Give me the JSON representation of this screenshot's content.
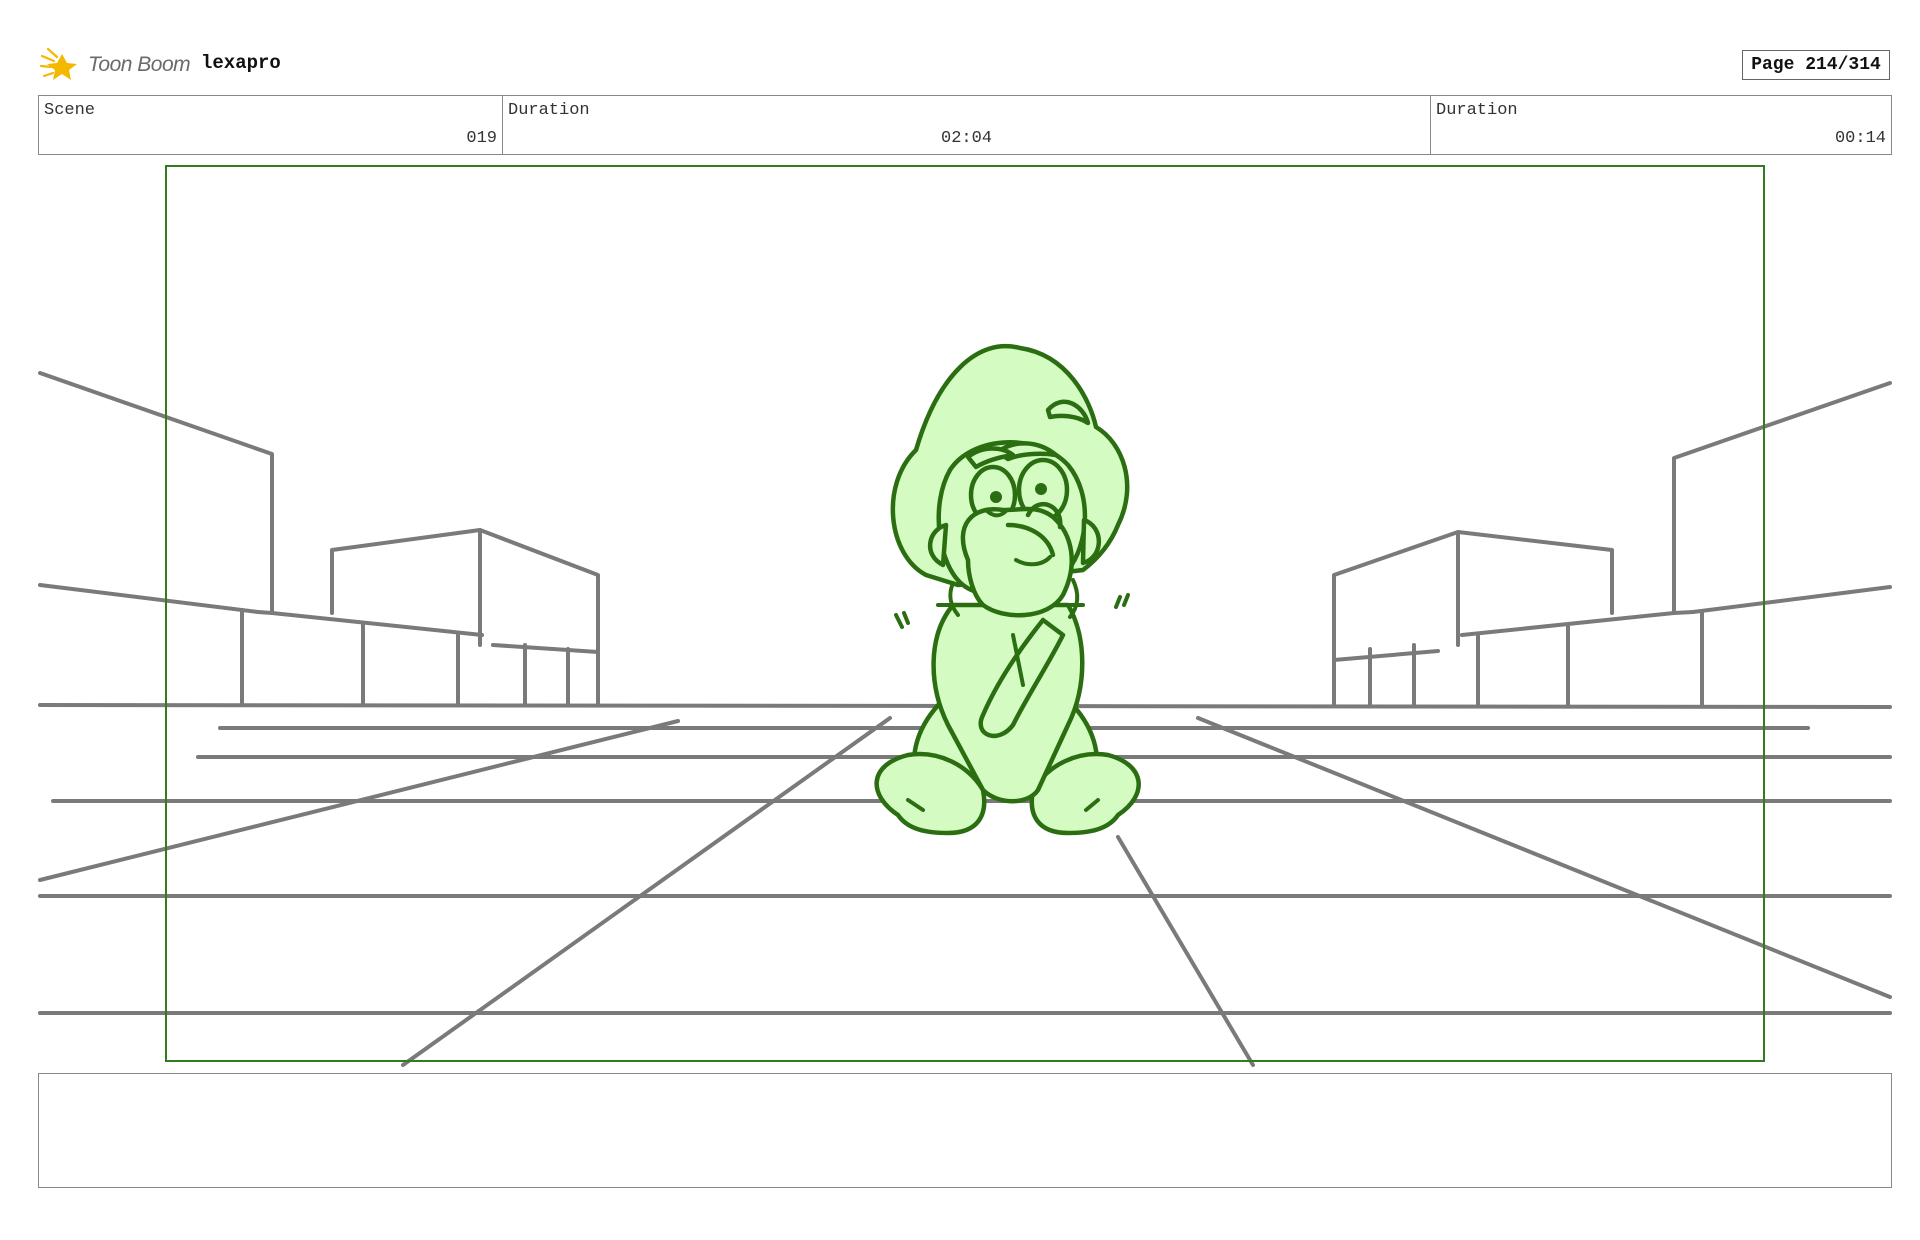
{
  "header": {
    "logo_text": "Toon Boom",
    "project_name": "lexapro",
    "page_label": "Page 214/314"
  },
  "info": {
    "scene_label": "Scene",
    "scene_value": "019",
    "duration1_label": "Duration",
    "duration1_value": "02:04",
    "duration2_label": "Duration",
    "duration2_value": "00:14"
  },
  "colors": {
    "frame_green": "#2f7d1f",
    "character_fill": "#d4fbc2",
    "character_line": "#2b6e12",
    "layout_gray": "#7a7a7a",
    "logo_yellow": "#f5b800"
  },
  "icons": {
    "logo": "toon-boom-star-icon"
  },
  "notes": {
    "text": ""
  }
}
